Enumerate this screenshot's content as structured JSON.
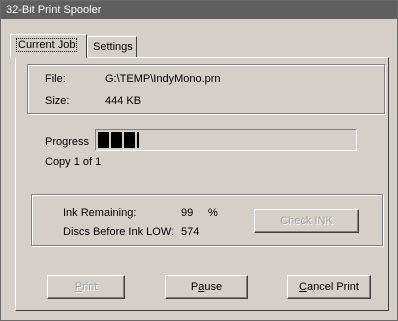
{
  "window": {
    "title": "32-Bit Print Spooler"
  },
  "tabs": [
    {
      "label": "Current Job",
      "active": true
    },
    {
      "label": "Settings",
      "active": false
    }
  ],
  "job": {
    "file_label": "File:",
    "file_value": "G:\\TEMP\\IndyMono.prn",
    "size_label": "Size:",
    "size_value": "444 KB"
  },
  "progress": {
    "label": "Progress",
    "fraction": 0.16,
    "copy_text": "Copy 1 of 1"
  },
  "ink": {
    "remaining_label": "Ink Remaining:",
    "remaining_value": "99",
    "remaining_unit": "%",
    "discs_label": "Discs Before Ink LOW:",
    "discs_value": "574",
    "check_button": "Check INK"
  },
  "buttons": {
    "print_first": "P",
    "print_rest": "rint",
    "pause_first": "P",
    "pause_u": "a",
    "pause_rest": "use",
    "cancel_u": "C",
    "cancel_rest": "ancel Print"
  }
}
